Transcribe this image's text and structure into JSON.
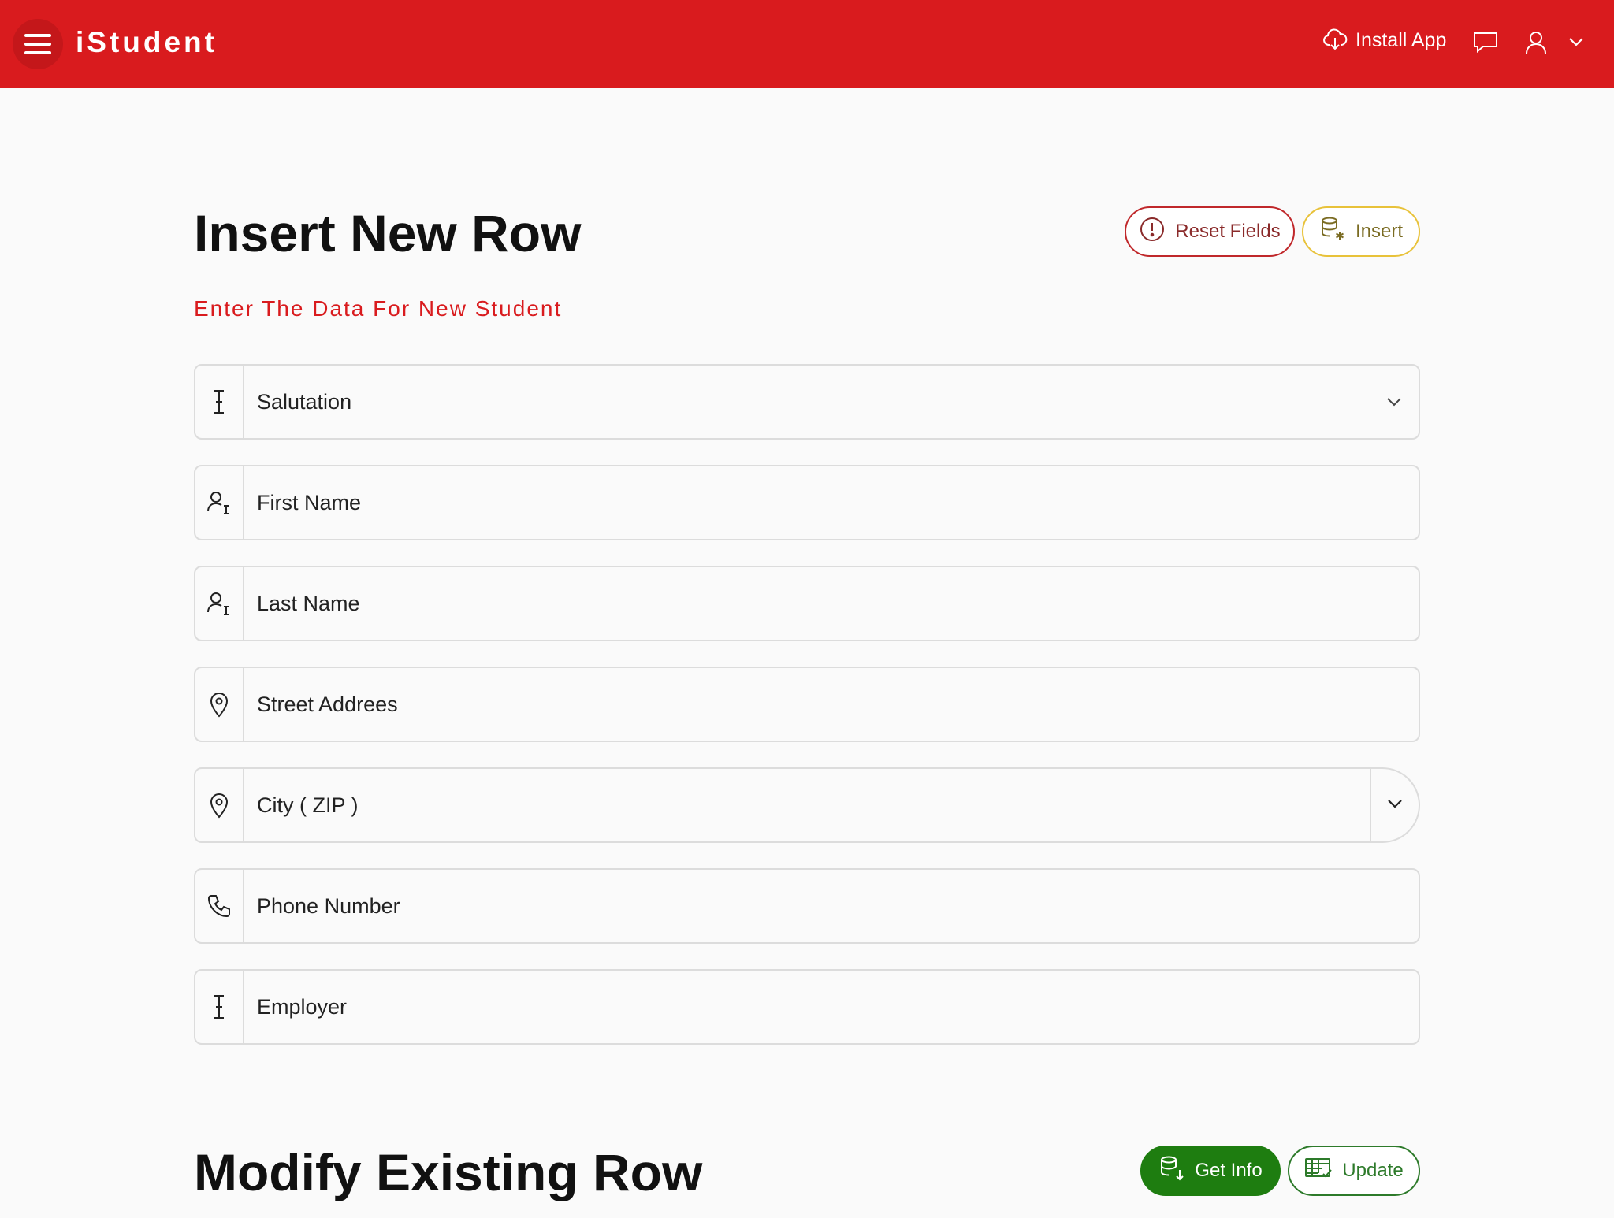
{
  "header": {
    "app_title": "iStudent",
    "install_label": "Install App"
  },
  "insert_section": {
    "title": "Insert New Row",
    "subtitle": "Enter The Data For New Student",
    "reset_label": "Reset Fields",
    "insert_label": "Insert",
    "fields": {
      "salutation": "Salutation",
      "first_name": "First Name",
      "last_name": "Last Name",
      "street": "Street Addrees",
      "city": "City ( ZIP )",
      "phone": "Phone Number",
      "employer": "Employer"
    }
  },
  "modify_section": {
    "title": "Modify Existing Row",
    "getinfo_label": "Get Info",
    "update_label": "Update"
  },
  "colors": {
    "brand_red": "#d91b1e",
    "reset_border": "#c0282b",
    "insert_border": "#e8c23a",
    "getinfo_bg": "#1e7d10",
    "update_border": "#2d7a2a"
  }
}
